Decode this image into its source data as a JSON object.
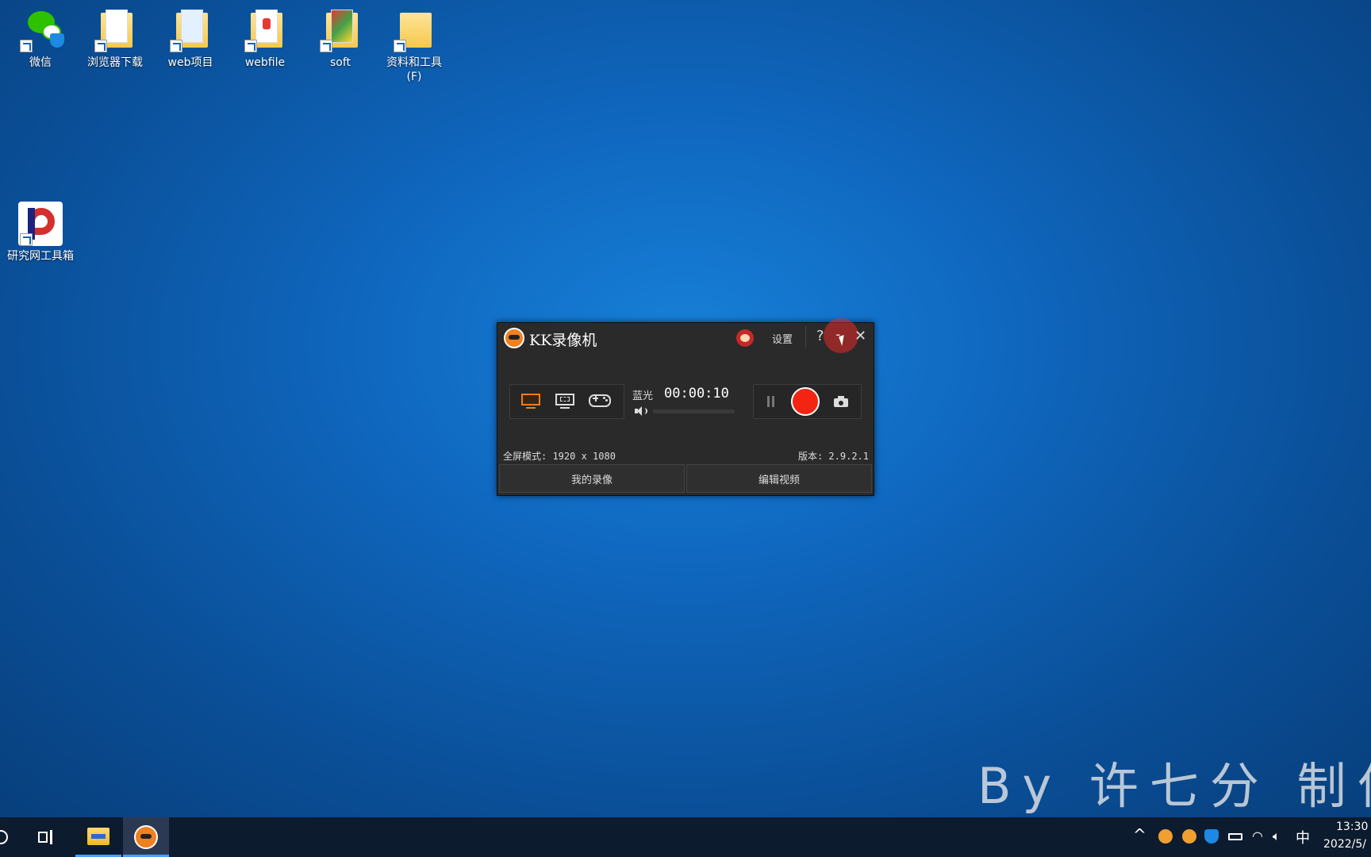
{
  "desktop": {
    "icons": [
      {
        "label": "微信",
        "icon": "wechat-icon"
      },
      {
        "label": "浏览器下载",
        "icon": "folder-icon"
      },
      {
        "label": "web项目",
        "icon": "folder-icon"
      },
      {
        "label": "webfile",
        "icon": "folder-icon"
      },
      {
        "label": "soft",
        "icon": "folder-icon"
      },
      {
        "label": "资料和工具",
        "sublabel": "(F)",
        "icon": "drive-folder-icon"
      },
      {
        "label": "研究网工具箱",
        "icon": "app-icon"
      }
    ]
  },
  "kk_window": {
    "title": "KK录像机",
    "settings_label": "设置",
    "help_label": "?",
    "minimize_label": "-",
    "close_label": "✕",
    "quality_label": "蓝光",
    "timer": "00:00:10",
    "volume_level": 0.0,
    "mode_info": "全屏模式: 1920 x 1080",
    "version": "版本: 2.9.2.1",
    "my_recordings_label": "我的录像",
    "edit_video_label": "编辑视频",
    "modes": [
      "fullscreen-mode-icon",
      "region-mode-icon",
      "game-mode-icon"
    ],
    "colors": {
      "accent": "#f07d1a",
      "record": "#f42412",
      "background": "#2a2a2a"
    }
  },
  "watermark": "By 许七分 制作",
  "taskbar": {
    "ime": "中",
    "time": "13:30",
    "date": "2022/5/"
  }
}
